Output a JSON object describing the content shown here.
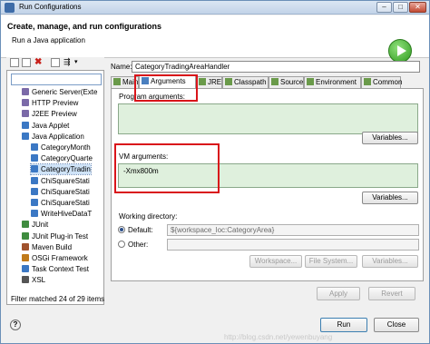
{
  "window": {
    "title": "Run Configurations"
  },
  "header": {
    "title": "Create, manage, and run configurations",
    "subtitle": "Run a Java application"
  },
  "tree": {
    "items": [
      {
        "label": "Generic Server(Exte",
        "icon": "server-icon",
        "color": "#7b6aa8",
        "indent": 0
      },
      {
        "label": "HTTP Preview",
        "icon": "preview-icon",
        "color": "#7b6aa8",
        "indent": 0
      },
      {
        "label": "J2EE Preview",
        "icon": "preview-icon",
        "color": "#7b6aa8",
        "indent": 0
      },
      {
        "label": "Java Applet",
        "icon": "applet-icon",
        "color": "#3b78c4",
        "indent": 0
      },
      {
        "label": "Java Application",
        "icon": "java-app-icon",
        "color": "#3b78c4",
        "indent": 0
      },
      {
        "label": "CategoryMonth",
        "icon": "java-config-icon",
        "color": "#3b78c4",
        "indent": 1
      },
      {
        "label": "CategoryQuarte",
        "icon": "java-config-icon",
        "color": "#3b78c4",
        "indent": 1
      },
      {
        "label": "CategoryTradin",
        "icon": "java-config-icon",
        "color": "#3b78c4",
        "indent": 1,
        "selected": true
      },
      {
        "label": "ChiSquareStati",
        "icon": "java-config-icon",
        "color": "#3b78c4",
        "indent": 1
      },
      {
        "label": "ChiSquareStati",
        "icon": "java-config-icon",
        "color": "#3b78c4",
        "indent": 1
      },
      {
        "label": "ChiSquareStati",
        "icon": "java-config-icon",
        "color": "#3b78c4",
        "indent": 1
      },
      {
        "label": "WriteHiveDataT",
        "icon": "java-config-icon",
        "color": "#3b78c4",
        "indent": 1
      },
      {
        "label": "JUnit",
        "icon": "junit-icon",
        "color": "#3f8c3f",
        "indent": 0
      },
      {
        "label": "JUnit Plug-in Test",
        "icon": "junit-plugin-icon",
        "color": "#3f8c3f",
        "indent": 0
      },
      {
        "label": "Maven Build",
        "icon": "maven-icon",
        "color": "#a0522d",
        "indent": 0
      },
      {
        "label": "OSGi Framework",
        "icon": "osgi-icon",
        "color": "#c07a1a",
        "indent": 0
      },
      {
        "label": "Task Context Test",
        "icon": "task-icon",
        "color": "#3b78c4",
        "indent": 0
      },
      {
        "label": "XSL",
        "icon": "xsl-icon",
        "color": "#555555",
        "indent": 0
      }
    ],
    "filter_status": "Filter matched 24 of 29 items"
  },
  "config": {
    "name_label": "Name:",
    "name_value": "CategoryTradingAreaHandler",
    "tabs": [
      {
        "label": "Main",
        "icon": "main-tab-icon",
        "active": false
      },
      {
        "label": "Arguments",
        "icon": "arguments-tab-icon",
        "active": true
      },
      {
        "label": "JRE",
        "icon": "jre-tab-icon",
        "active": false
      },
      {
        "label": "Classpath",
        "icon": "classpath-tab-icon",
        "active": false
      },
      {
        "label": "Source",
        "icon": "source-tab-icon",
        "active": false
      },
      {
        "label": "Environment",
        "icon": "environment-tab-icon",
        "active": false
      },
      {
        "label": "Common",
        "icon": "common-tab-icon",
        "active": false
      }
    ],
    "program_args_label": "Program arguments:",
    "program_args_value": "",
    "program_variables": "Variables...",
    "vm_args_label": "VM arguments:",
    "vm_args_value": "-Xmx800m",
    "vm_variables": "Variables...",
    "workdir_label": "Working directory:",
    "default_label": "Default:",
    "default_value": "${workspace_loc:CategoryArea}",
    "other_label": "Other:",
    "workspace_btn": "Workspace...",
    "filesystem_btn": "File System...",
    "workdir_variables": "Variables...",
    "apply": "Apply",
    "revert": "Revert"
  },
  "footer": {
    "run": "Run",
    "close": "Close"
  },
  "watermark": "http://blog.csdn.net/yewenbuyang",
  "colors": {
    "highlight": "#d9141a",
    "textarea_bg": "#dff0dd",
    "selection": "#cfe3f7"
  }
}
